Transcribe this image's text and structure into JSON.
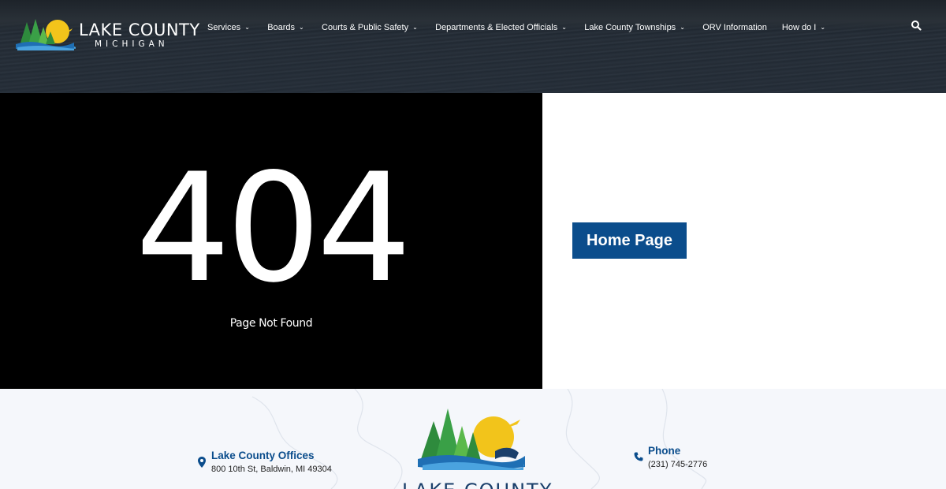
{
  "header": {
    "logo_title": "LAKE COUNTY",
    "logo_subtitle": "MICHIGAN",
    "nav": [
      {
        "label": "Services",
        "dropdown": true
      },
      {
        "label": "Boards",
        "dropdown": true
      },
      {
        "label": "Courts & Public Safety",
        "dropdown": true
      },
      {
        "label": "Departments & Elected Officials",
        "dropdown": true
      },
      {
        "label": "Lake County Townships",
        "dropdown": true
      },
      {
        "label": "ORV Information",
        "dropdown": false
      },
      {
        "label": "How do I",
        "dropdown": true
      }
    ],
    "search_icon": "search-icon"
  },
  "error": {
    "code": "404",
    "message": "Page Not Found"
  },
  "home_button": {
    "label": "Home Page"
  },
  "footer": {
    "office_title": "Lake County Offices",
    "office_address": "800 10th St, Baldwin, MI 49304",
    "phone_title": "Phone",
    "phone_number": "(231) 745-2776",
    "logo_text": "LAKE COUNTY"
  },
  "colors": {
    "brand_blue": "#0b4d8c",
    "panel_black": "#000000",
    "footer_bg": "#f5f7fb"
  }
}
